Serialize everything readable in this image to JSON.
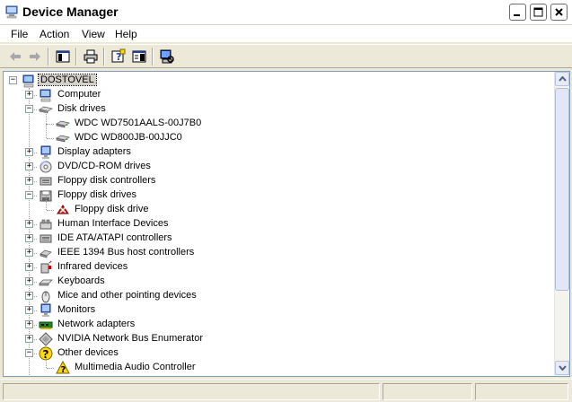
{
  "window": {
    "title": "Device Manager",
    "icon": "device-manager-icon"
  },
  "menu": {
    "items": [
      "File",
      "Action",
      "View",
      "Help"
    ]
  },
  "toolbar": {
    "buttons": [
      {
        "name": "back-button",
        "icon": "back-arrow-icon"
      },
      {
        "name": "forward-button",
        "icon": "forward-arrow-icon"
      },
      {
        "name": "show-hide-console-tree-button",
        "icon": "console-tree-icon"
      },
      {
        "name": "print-button",
        "icon": "printer-icon"
      },
      {
        "name": "help-button",
        "icon": "help-icon"
      },
      {
        "name": "properties-button",
        "icon": "properties-icon"
      },
      {
        "name": "scan-hardware-button",
        "icon": "scan-hardware-icon"
      }
    ]
  },
  "tree": {
    "root": {
      "label": "DOSTOVEL",
      "icon": "computer-icon"
    },
    "items": [
      {
        "label": "Computer",
        "icon": "computer-icon",
        "level": 1,
        "expander": "+"
      },
      {
        "label": "Disk drives",
        "icon": "disk-drive-icon",
        "level": 1,
        "expander": "-"
      },
      {
        "label": "WDC WD7501AALS-00J7B0",
        "icon": "hard-disk-icon",
        "level": 2,
        "expander": ""
      },
      {
        "label": "WDC WD800JB-00JJC0",
        "icon": "hard-disk-icon",
        "level": 2,
        "expander": ""
      },
      {
        "label": "Display adapters",
        "icon": "monitor-icon",
        "level": 1,
        "expander": "+"
      },
      {
        "label": "DVD/CD-ROM drives",
        "icon": "cdrom-icon",
        "level": 1,
        "expander": "+"
      },
      {
        "label": "Floppy disk controllers",
        "icon": "controller-icon",
        "level": 1,
        "expander": "+"
      },
      {
        "label": "Floppy disk drives",
        "icon": "floppy-icon",
        "level": 1,
        "expander": "-"
      },
      {
        "label": "Floppy disk drive",
        "icon": "disabled-device-icon",
        "level": 2,
        "expander": ""
      },
      {
        "label": "Human Interface Devices",
        "icon": "hid-icon",
        "level": 1,
        "expander": "+"
      },
      {
        "label": "IDE ATA/ATAPI controllers",
        "icon": "controller-icon",
        "level": 1,
        "expander": "+"
      },
      {
        "label": "IEEE 1394 Bus host controllers",
        "icon": "firewire-icon",
        "level": 1,
        "expander": "+"
      },
      {
        "label": "Infrared devices",
        "icon": "infrared-icon",
        "level": 1,
        "expander": "+"
      },
      {
        "label": "Keyboards",
        "icon": "keyboard-icon",
        "level": 1,
        "expander": "+"
      },
      {
        "label": "Mice and other pointing devices",
        "icon": "mouse-icon",
        "level": 1,
        "expander": "+"
      },
      {
        "label": "Monitors",
        "icon": "monitor-icon",
        "level": 1,
        "expander": "+"
      },
      {
        "label": "Network adapters",
        "icon": "network-card-icon",
        "level": 1,
        "expander": "+"
      },
      {
        "label": "NVIDIA Network Bus Enumerator",
        "icon": "bus-enumerator-icon",
        "level": 1,
        "expander": "+"
      },
      {
        "label": "Other devices",
        "icon": "unknown-device-icon",
        "level": 1,
        "expander": "-"
      },
      {
        "label": "Multimedia Audio Controller",
        "icon": "warning-device-icon",
        "level": 2,
        "expander": ""
      }
    ]
  },
  "colors": {
    "selection": "#d4d0c8",
    "border": "#7f9db9",
    "chrome": "#ece9d8"
  }
}
